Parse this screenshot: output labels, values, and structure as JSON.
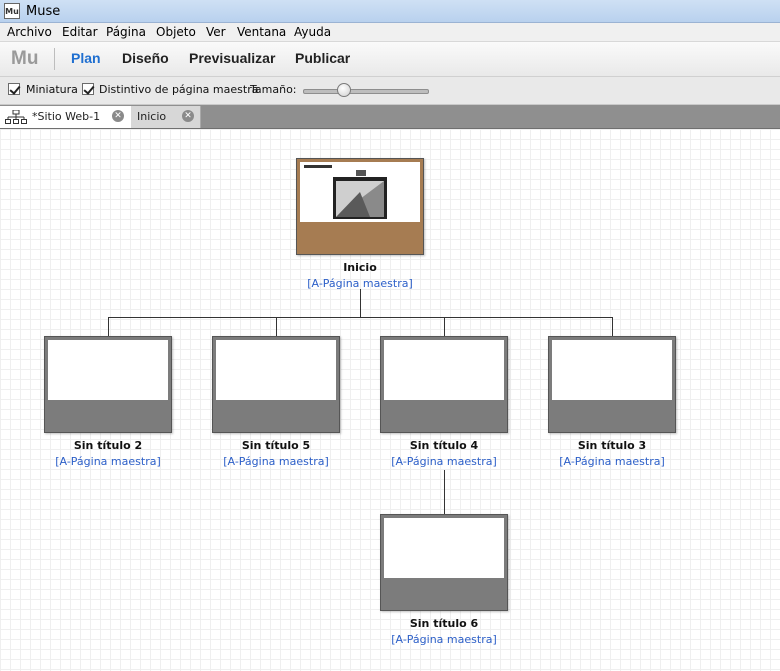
{
  "window": {
    "title": "Muse",
    "icon_text": "Mu"
  },
  "menu": [
    "Archivo",
    "Editar",
    "Página",
    "Objeto",
    "Ver",
    "Ventana",
    "Ayuda"
  ],
  "modes": {
    "logo": "Mu",
    "items": [
      "Plan",
      "Diseño",
      "Previsualizar",
      "Publicar"
    ],
    "active": "Plan"
  },
  "options": {
    "thumbnail": {
      "label": "Miniatura",
      "checked": true
    },
    "master_badge": {
      "label": "Distintivo de página maestra",
      "checked": true
    },
    "size_label": "Tamaño:",
    "size_value": 0.3
  },
  "tabs": [
    {
      "label": "*Sitio Web-1",
      "active": true,
      "icon": "sitemap-icon"
    },
    {
      "label": "Inicio",
      "active": false
    }
  ],
  "site": {
    "home": {
      "title": "Inicio",
      "master": "[A-Página maestra]"
    },
    "children": [
      {
        "title": "Sin título 2",
        "master": "[A-Página maestra]"
      },
      {
        "title": "Sin título 5",
        "master": "[A-Página maestra]"
      },
      {
        "title": "Sin título 4",
        "master": "[A-Página maestra]"
      },
      {
        "title": "Sin título 3",
        "master": "[A-Página maestra]"
      }
    ],
    "grandchild": {
      "title": "Sin título 6",
      "master": "[A-Página maestra]"
    }
  },
  "colors": {
    "accent": "#1f6fd0",
    "link": "#2c5fc8",
    "home_frame": "#a67c52",
    "page_frame": "#7c7c7c"
  }
}
